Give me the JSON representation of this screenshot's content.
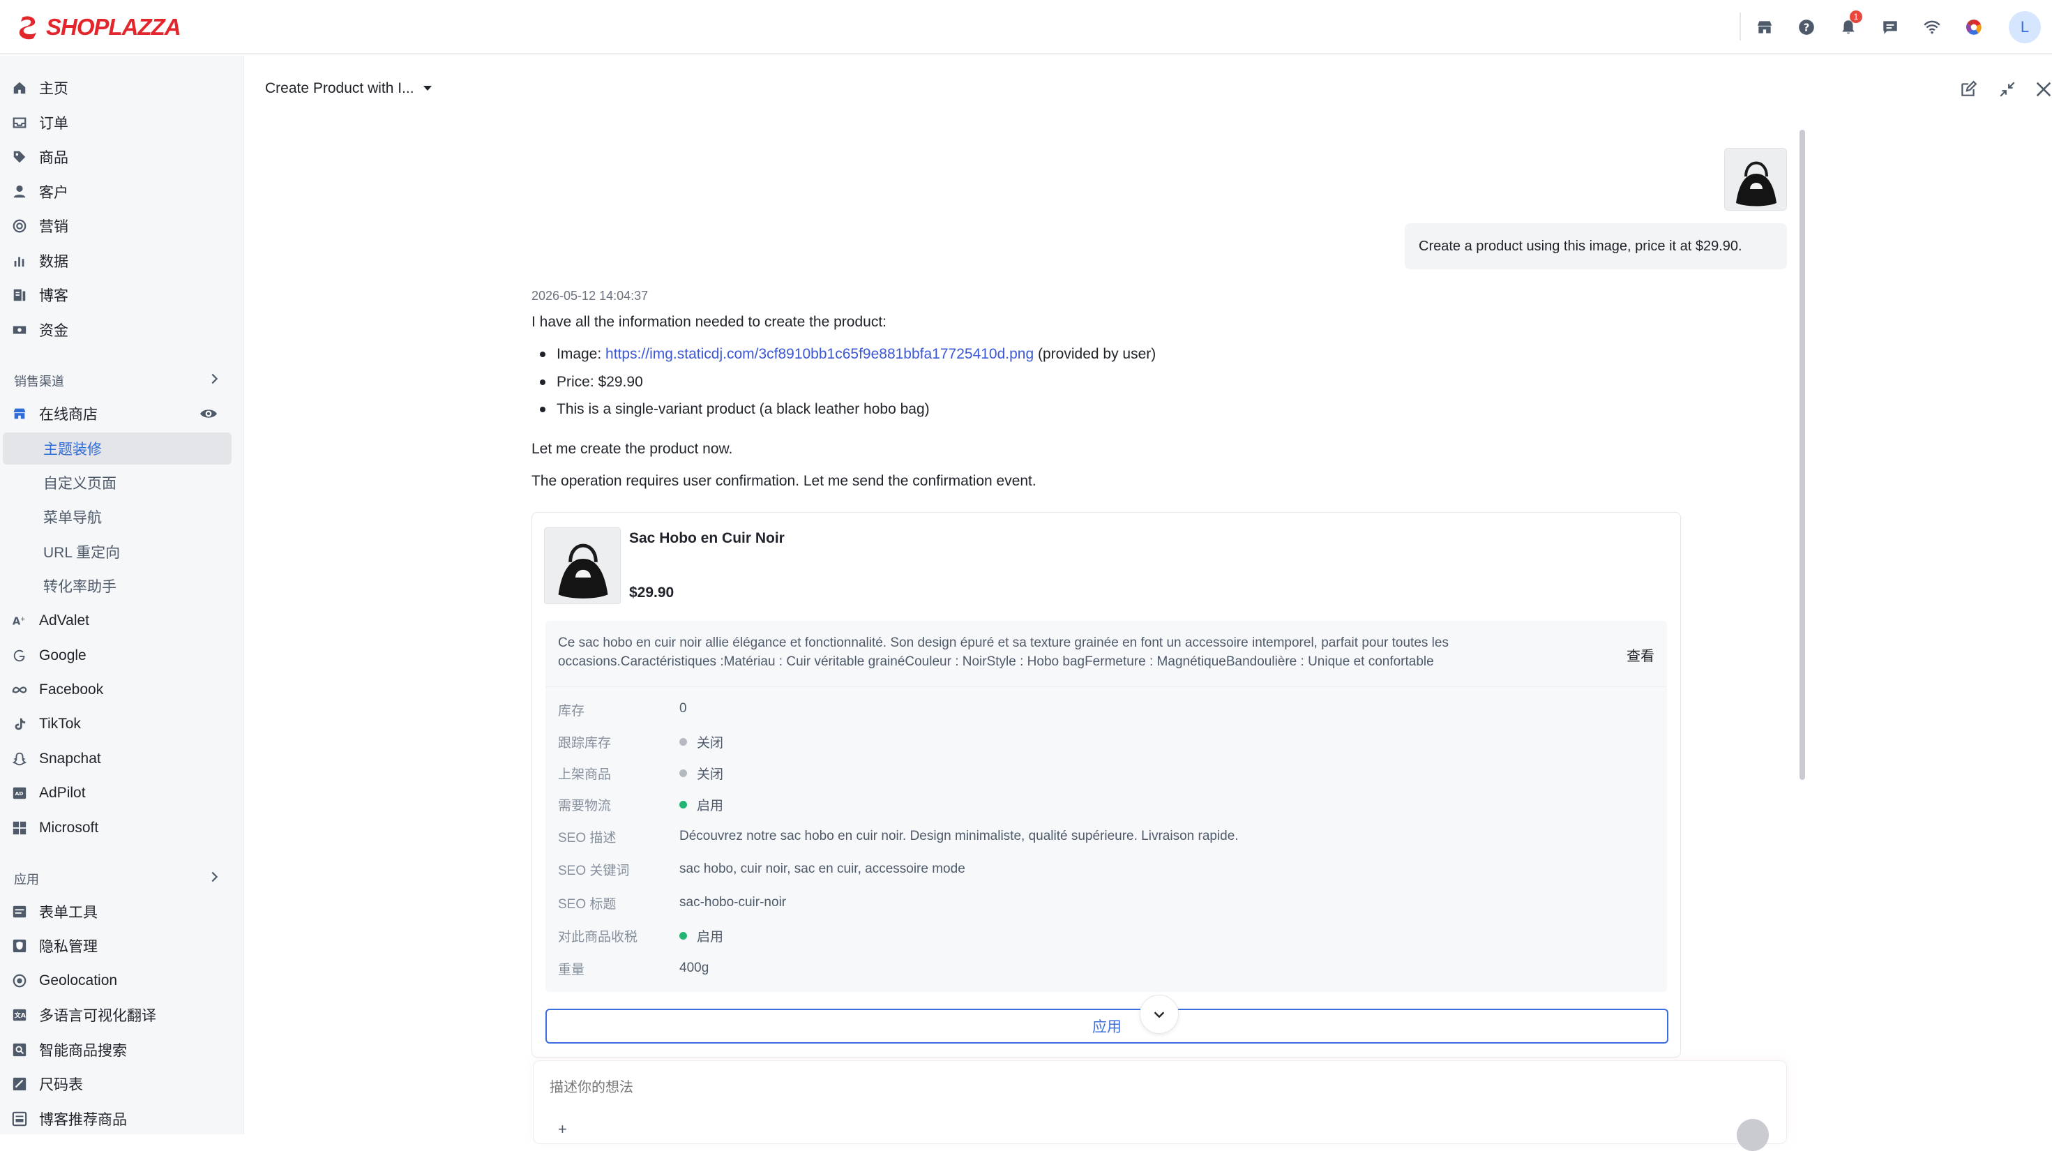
{
  "brand": {
    "name": "SHOPLAZZA",
    "color": "#e3262b"
  },
  "topbar": {
    "icons": [
      "store-icon",
      "help-icon",
      "bell-icon",
      "chat-icon",
      "wifi-icon",
      "color-wheel-icon"
    ],
    "notification_count": "1",
    "avatar_letter": "L"
  },
  "sidebar": {
    "main_items": [
      {
        "label": "主页",
        "icon": "home-icon"
      },
      {
        "label": "订单",
        "icon": "inbox-icon"
      },
      {
        "label": "商品",
        "icon": "tag-icon"
      },
      {
        "label": "客户",
        "icon": "person-icon"
      },
      {
        "label": "营销",
        "icon": "target-icon"
      },
      {
        "label": "数据",
        "icon": "bar-chart-icon"
      },
      {
        "label": "博客",
        "icon": "blog-icon"
      },
      {
        "label": "资金",
        "icon": "money-icon"
      }
    ],
    "sales_channels_label": "销售渠道",
    "online_store_label": "在线商店",
    "online_store_sub": [
      {
        "label": "主题装修",
        "active": true
      },
      {
        "label": "自定义页面"
      },
      {
        "label": "菜单导航"
      },
      {
        "label": "URL 重定向"
      },
      {
        "label": "转化率助手"
      }
    ],
    "channels": [
      {
        "label": "AdValet",
        "icon": "advalet-icon"
      },
      {
        "label": "Google",
        "icon": "google-icon"
      },
      {
        "label": "Facebook",
        "icon": "meta-icon"
      },
      {
        "label": "TikTok",
        "icon": "tiktok-icon"
      },
      {
        "label": "Snapchat",
        "icon": "snapchat-icon"
      },
      {
        "label": "AdPilot",
        "icon": "adpilot-icon"
      },
      {
        "label": "Microsoft",
        "icon": "microsoft-icon"
      }
    ],
    "apps_label": "应用",
    "apps": [
      {
        "label": "表单工具",
        "icon": "form-icon"
      },
      {
        "label": "隐私管理",
        "icon": "privacy-icon"
      },
      {
        "label": "Geolocation",
        "icon": "geolocation-icon"
      },
      {
        "label": "多语言可视化翻译",
        "icon": "translate-icon"
      },
      {
        "label": "智能商品搜索",
        "icon": "smart-search-icon"
      },
      {
        "label": "尺码表",
        "icon": "size-chart-icon"
      },
      {
        "label": "博客推荐商品",
        "icon": "blog-product-icon"
      }
    ]
  },
  "panel": {
    "title": "Create Product with I...",
    "user_message": "Create a product using this image, price it at $29.90.",
    "assistant": {
      "timestamp": "2026-05-12 14:04:37",
      "intro": "I have all the information needed to create the product:",
      "bullets": {
        "image_prefix": "Image: ",
        "image_url": "https://img.staticdj.com/3cf8910bb1c65f9e881bbfa17725410d.png",
        "image_suffix": " (provided by user)",
        "price": "Price: $29.90",
        "variant": "This is a single-variant product (a black leather hobo bag)"
      },
      "line2": "Let me create the product now.",
      "line3": "The operation requires user confirmation. Let me send the confirmation event."
    },
    "product": {
      "name": "Sac Hobo en Cuir Noir",
      "price": "$29.90",
      "description": "Ce sac hobo en cuir noir allie élégance et fonctionnalité. Son design épuré et sa texture grainée en font un accessoire intemporel, parfait pour toutes les occasions.Caractéristiques :Matériau : Cuir véritable grainéCouleur : NoirStyle : Hobo bagFermeture : MagnétiqueBandoulière : Unique et confortable",
      "view_label": "查看",
      "fields": [
        {
          "label": "库存",
          "value": "0"
        },
        {
          "label": "跟踪库存",
          "value": "关闭",
          "status": "off"
        },
        {
          "label": "上架商品",
          "value": "关闭",
          "status": "off"
        },
        {
          "label": "需要物流",
          "value": "启用",
          "status": "on"
        },
        {
          "label": "SEO 描述",
          "value": "Découvrez notre sac hobo en cuir noir. Design minimaliste, qualité supérieure. Livraison rapide."
        },
        {
          "label": "SEO 关键词",
          "value": "sac hobo, cuir noir, sac en cuir, accessoire mode"
        },
        {
          "label": "SEO 标题",
          "value": "sac-hobo-cuir-noir"
        },
        {
          "label": "对此商品收税",
          "value": "启用",
          "status": "on"
        },
        {
          "label": "重量",
          "value": "400g"
        }
      ],
      "apply_label": "应用"
    },
    "input_placeholder": "描述你的想法",
    "plus_label": "+"
  }
}
